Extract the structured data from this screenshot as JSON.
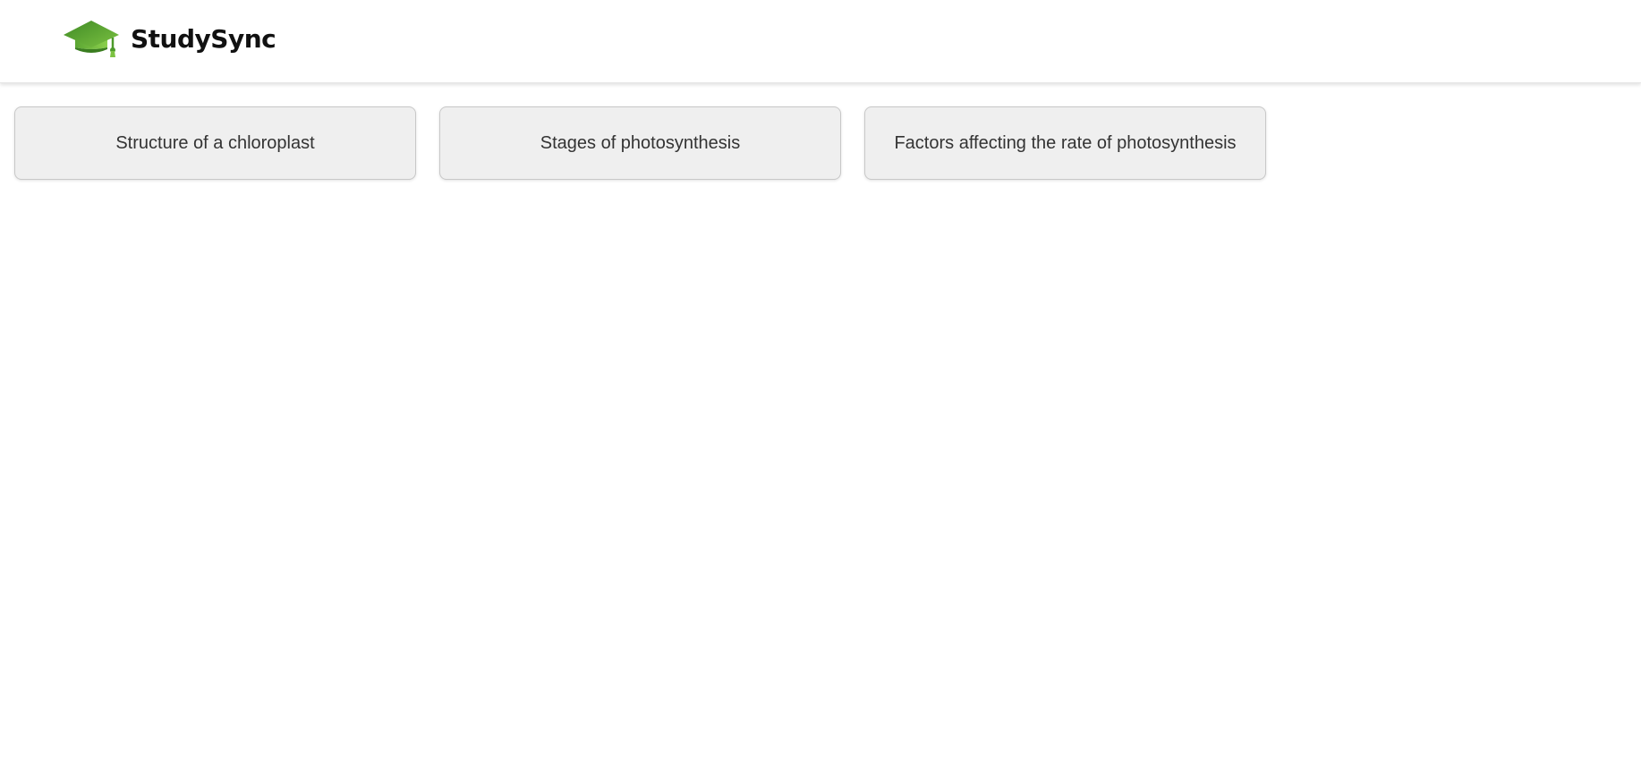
{
  "header": {
    "brand_name": "StudySync",
    "logo_icon": "graduation-cap-icon",
    "logo_colors": {
      "primary": "#4c9a2a",
      "secondary": "#7cc242"
    }
  },
  "topics": [
    {
      "label": "Structure of a chloroplast"
    },
    {
      "label": "Stages of photosynthesis"
    },
    {
      "label": "Factors affecting the rate of photosynthesis"
    }
  ]
}
